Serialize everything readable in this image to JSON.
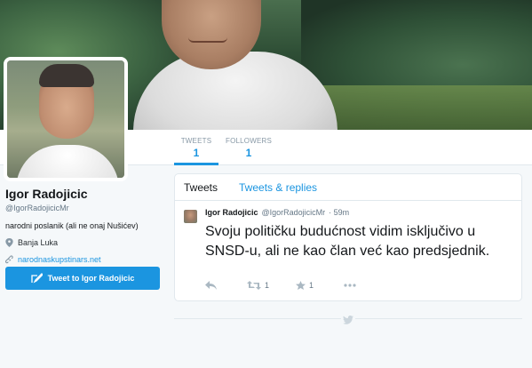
{
  "stats": {
    "tweets_label": "TWEETS",
    "tweets_count": "1",
    "followers_label": "FOLLOWERS",
    "followers_count": "1"
  },
  "profile": {
    "name": "Igor Radojicic",
    "handle": "@IgorRadojicicMr",
    "bio": "narodni poslanik (ali ne onaj Nušićev)",
    "location": "Banja Luka",
    "website": "narodnaskupstinars.net",
    "tweet_to_label": "Tweet to Igor Radojicic"
  },
  "timeline": {
    "tabs": [
      {
        "label": "Tweets"
      },
      {
        "label": "Tweets & replies"
      }
    ],
    "tweet": {
      "name": "Igor Radojicic",
      "handle": "@IgorRadojicicMr",
      "time": "· 59m",
      "text": "Svoju političku budućnost vidim isključivo u SNSD-u, ali ne kao član već kao predsjednik.",
      "retweets": "1",
      "likes": "1"
    }
  },
  "colors": {
    "accent": "#1b95e0",
    "background": "#f5f8fa"
  }
}
